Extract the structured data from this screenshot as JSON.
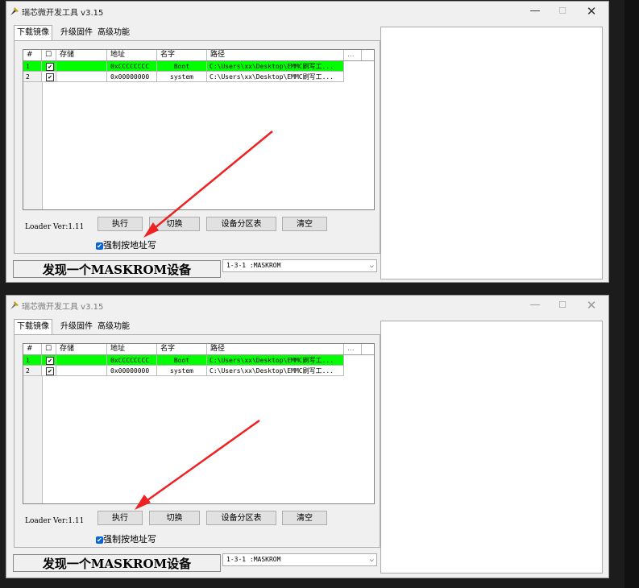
{
  "window": {
    "title": "瑞芯微开发工具 v3.15",
    "min": "—",
    "max": "☐",
    "close": "✕"
  },
  "tabs": [
    "下载镜像",
    "升级固件",
    "高级功能"
  ],
  "table": {
    "headers": [
      "#",
      "☐",
      "存储",
      "地址",
      "名字",
      "路径",
      "..."
    ],
    "rows": [
      {
        "index": "1",
        "checked": "✔",
        "storage": "",
        "address": "0xCCCCCCCC",
        "name": "Boot",
        "path": "C:\\Users\\xx\\Desktop\\EMMC刷写工..."
      },
      {
        "index": "2",
        "checked": "✔",
        "storage": "",
        "address": "0x00000000",
        "name": "system",
        "path": "C:\\Users\\xx\\Desktop\\EMMC刷写工..."
      }
    ]
  },
  "loader_version": "Loader Ver:1.11",
  "buttons": {
    "execute": "执行",
    "switch": "切换",
    "partition": "设备分区表",
    "clear": "清空"
  },
  "force_address": {
    "label": "强制按地址写",
    "checked": "✔"
  },
  "status_text": "发现一个MASKROM设备",
  "device_select": {
    "value": "1-3-1 :MASKROM",
    "arrow": "⌵"
  },
  "colors": {
    "selected_row": "#00ff00",
    "annotation_arrow": "#ee2222",
    "checkbox_accent": "#0a64d8"
  }
}
